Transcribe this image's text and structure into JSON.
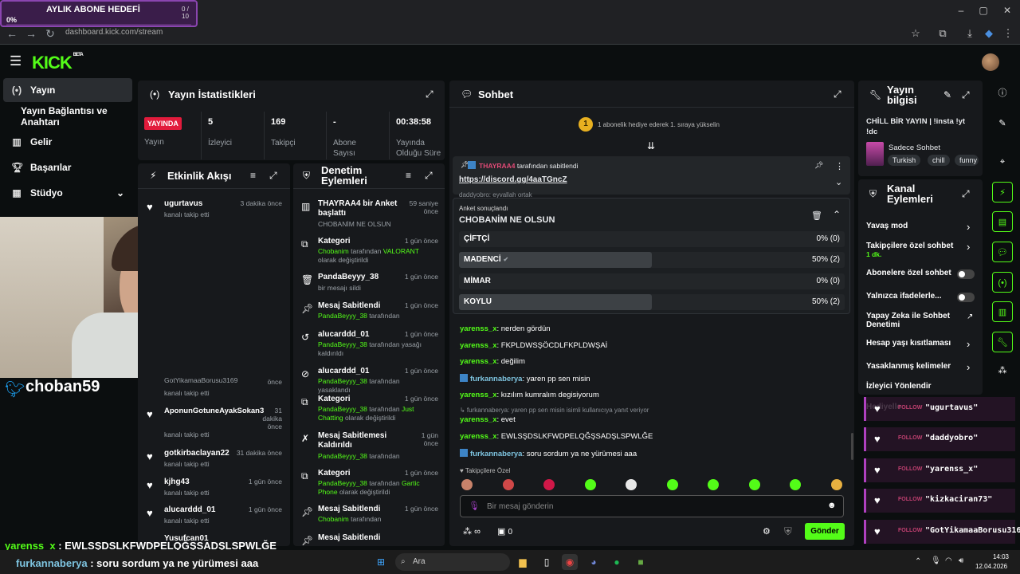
{
  "browser": {
    "url": "dashboard.kick.com/stream",
    "window_controls": [
      "–",
      "▢",
      "✕"
    ]
  },
  "overlay_goal": {
    "title": "AYLIK ABONE HEDEFİ",
    "count": "0 / 10",
    "percent_label": "0%",
    "progress": 0.0
  },
  "kick": {
    "logo": "KICK",
    "beta": "BETA"
  },
  "sidebar": {
    "items": [
      {
        "label": "Yayın",
        "icon": "broadcast-icon"
      },
      {
        "label": "Yayın Bağlantısı ve Anahtarı",
        "icon": ""
      },
      {
        "label": "Gelir",
        "icon": "chart-icon"
      },
      {
        "label": "Başarılar",
        "icon": "trophy-icon"
      },
      {
        "label": "Stüdyo",
        "icon": "studio-icon"
      }
    ]
  },
  "stats": {
    "title": "Yayın İstatistikleri",
    "live_badge": "YAYINDA",
    "live_label": "Yayın",
    "cells": [
      {
        "value": "5",
        "label": "İzleyici"
      },
      {
        "value": "169",
        "label": "Takipçi"
      },
      {
        "value": "-",
        "label": "Abone Sayısı"
      },
      {
        "value": "00:38:58",
        "label": "Yayında Olduğu Süre"
      }
    ]
  },
  "activity": {
    "title": "Etkinlik Akışı",
    "rows": [
      {
        "name": "ugurtavus",
        "time": "3 dakika önce",
        "desc": "kanalı takip etti"
      },
      {
        "name": "GotYikamaaBorusu3169",
        "time": "önce",
        "desc": "kanalı takip etti"
      },
      {
        "name": "AponunGotuneAyakSokan3",
        "time": "31 dakika önce",
        "desc": "kanalı takip etti"
      },
      {
        "name": "gotkirbaclayan22",
        "time": "31 dakika önce",
        "desc": "kanalı takip etti"
      },
      {
        "name": "kjhg43",
        "time": "1 gün önce",
        "desc": "kanalı takip etti"
      },
      {
        "name": "alucarddd_01",
        "time": "1 gün önce",
        "desc": "kanalı takip etti"
      },
      {
        "name": "Yusufcan01",
        "time": "",
        "desc": ""
      }
    ]
  },
  "moderation": {
    "title": "Denetim Eylemleri",
    "rows": [
      {
        "name": "THAYRAA4 bir Anket başlattı",
        "time": "59 saniye önce",
        "desc": "CHOBANİM NE OLSUN",
        "icon": "poll-icon"
      },
      {
        "name": "Kategori",
        "time": "1 gün önce",
        "desc_user": "Chobanim",
        "desc_mid": " tarafından ",
        "desc_hl": "VALORANT",
        "desc_end": " olarak değiştirildi",
        "icon": "category-icon"
      },
      {
        "name": "PandaBeyyy_38",
        "time": "1 gün önce",
        "desc": "bir mesajı sildi",
        "icon": "trash-icon"
      },
      {
        "name": "Mesaj Sabitlendi",
        "time": "1 gün önce",
        "desc_user": "PandaBeyyy_38",
        "desc_end": " tarafından",
        "icon": "pin-icon"
      },
      {
        "name": "alucarddd_01",
        "time": "1 gün önce",
        "desc_user": "PandaBeyyy_38",
        "desc_end": " tarafından yasağı kaldırıldı",
        "icon": "undo-icon"
      },
      {
        "name": "alucarddd_01",
        "time": "1 gün önce",
        "desc_user": "PandaBeyyy_38",
        "desc_end": " tarafından yasaklandı",
        "icon": "ban-icon"
      },
      {
        "name": "Kategori",
        "time": "1 gün önce",
        "desc_user": "PandaBeyyy_38",
        "desc_mid": " tarafından ",
        "desc_hl": "Just Chatting",
        "desc_end": " olarak değiştirildi",
        "icon": "category-icon"
      },
      {
        "name": "Mesaj Sabitlemesi Kaldırıldı",
        "time": "1 gün önce",
        "desc_user": "PandaBeyyy_38",
        "desc_end": " tarafından",
        "icon": "unpin-icon"
      },
      {
        "name": "Kategori",
        "time": "1 gün önce",
        "desc_user": "PandaBeyyy_38",
        "desc_mid": " tarafından ",
        "desc_hl": "Gartic Phone",
        "desc_end": " olarak değiştirildi",
        "icon": "category-icon"
      },
      {
        "name": "Mesaj Sabitlendi",
        "time": "1 gün önce",
        "desc_user": "Chobanim",
        "desc_end": " tarafından",
        "icon": "pin-icon"
      },
      {
        "name": "Mesaj Sabitlendi",
        "time": "1 gün önce",
        "desc": "",
        "icon": "pin-icon"
      }
    ]
  },
  "chat": {
    "title": "Sohbet",
    "gift_prompt": "1 abonelik hediye ederek 1. sıraya yükselin",
    "gift_rank": "1",
    "pinned": {
      "user": "THAYRAA4",
      "text": "tarafından sabitlendi",
      "link": "https://discord.gg/4aaTGncZ",
      "under": "daddyobro: eyvallah ortak"
    },
    "poll": {
      "status": "Anket sonuçlandı",
      "question": "CHOBANİM NE OLSUN",
      "options": [
        {
          "label": "ÇİFTÇİ",
          "value": "0% (0)",
          "share": 0.0,
          "winner": false
        },
        {
          "label": "MADENCİ",
          "value": "50% (2)",
          "share": 0.5,
          "winner": true
        },
        {
          "label": "MİMAR",
          "value": "0% (0)",
          "share": 0.0,
          "winner": false
        },
        {
          "label": "KOYLU",
          "value": "50% (2)",
          "share": 0.5,
          "winner": false
        }
      ]
    },
    "messages": [
      {
        "user": "yarenss_x",
        "text": ": nerden gördün",
        "kind": "green"
      },
      {
        "user": "yarenss_x",
        "text": ": FKPLDWSŞÖCDLFKPLDWŞAİ",
        "kind": "green"
      },
      {
        "user": "yarenss_x",
        "text": ": değilim",
        "kind": "green"
      },
      {
        "user": "furkannaberya",
        "text": ": yaren pp sen misin",
        "kind": "blue"
      },
      {
        "user": "yarenss_x",
        "text": ": kızılım kumralım degisiyorum",
        "kind": "green"
      },
      {
        "user": "",
        "text": "↳ furkannaberya: yaren pp sen misin isimli kullanıcıya yanıt veriyor",
        "kind": "reply"
      },
      {
        "user": "yarenss_x",
        "text": ": evet",
        "kind": "green"
      },
      {
        "user": "yarenss_x",
        "text": ": EWLSŞDSLKFWDPELQĞŞSADŞLSPWLĞE",
        "kind": "green"
      },
      {
        "user": "furkannaberya",
        "text": ": soru sordum ya ne yürümesi aaa",
        "kind": "blue"
      }
    ],
    "followers_only": "Takipçilere Özel",
    "input_placeholder": "Bir mesaj gönderin",
    "infinity": "∞",
    "gift_count": "0",
    "send_label": "Gönder"
  },
  "info": {
    "title": "Yayın bilgisi",
    "stream_title": "CHİLL BİR YAYIN | !insta !yt !dc",
    "category": "Sadece Sohbet",
    "tags": [
      "Turkish",
      "chill",
      "funny"
    ]
  },
  "channel_actions": {
    "title": "Kanal Eylemleri",
    "items": [
      {
        "label": "Yavaş mod",
        "sub": "",
        "control": "chevron"
      },
      {
        "label": "Takipçilere özel sohbet",
        "sub": "1 dk.",
        "control": "chevron"
      },
      {
        "label": "Abonelere özel sohbet",
        "sub": "",
        "control": "toggle"
      },
      {
        "label": "Yalnızca ifadelerle...",
        "sub": "",
        "control": "toggle"
      },
      {
        "label": "Yapay Zeka ile Sohbet Denetimi",
        "sub": "",
        "control": "external"
      },
      {
        "label": "Hesap yaşı kısıtlaması",
        "sub": "",
        "control": "chevron"
      },
      {
        "label": "Yasaklanmış kelimeler",
        "sub": "",
        "control": "chevron"
      },
      {
        "label": "İzleyici Yönlendir",
        "sub": "",
        "control": ""
      },
      {
        "label": "Hediyelle",
        "sub": "",
        "control": "chevron"
      }
    ]
  },
  "follow_alerts": {
    "tag": "FOLLOW",
    "names": [
      "\"ugurtavus\"",
      "\"daddyobro\"",
      "\"yarenss_x\"",
      "\"kizkaciran73\"",
      "\"GotYikamaaBorusu3169\""
    ]
  },
  "overlay": {
    "twitter_handle": "choban59",
    "bottom_lines": [
      {
        "user": "yarenss_x",
        "text": " : EWLSŞDSLKFWDPELQĞŞSADŞLSPWLĞE"
      },
      {
        "user": "furkannaberya",
        "text": " : soru sordum ya ne yürümesi aaa"
      }
    ]
  },
  "taskbar": {
    "search_placeholder": "Ara",
    "time": "14:03",
    "date": "12.04.2026"
  },
  "colors": {
    "kick_green": "#53fc18",
    "panel": "#17191c",
    "live_red": "#e21b3c"
  }
}
